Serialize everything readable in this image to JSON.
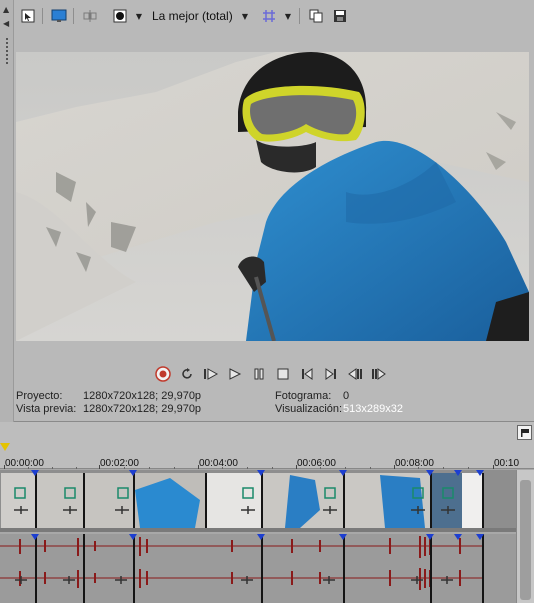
{
  "preview": {
    "toolbar": {
      "quality": "La mejor (total)",
      "icons": [
        "preview-properties-icon",
        "external-monitor-icon",
        "split-screen-icon",
        "adjust-size-icon",
        "overlays-icon",
        "copy-snapshot-icon",
        "save-snapshot-icon"
      ]
    },
    "info": {
      "project_label": "Proyecto:",
      "project_value": "1280x720x128; 29,970p",
      "preview_label": "Vista previa:",
      "preview_value": "1280x720x128; 29,970p",
      "frame_label": "Fotograma:",
      "frame_value": "0",
      "display_label": "Visualización:",
      "display_value": "513x289x32"
    },
    "transport": [
      "record-icon",
      "loop-icon",
      "play-from-start-icon",
      "play-icon",
      "pause-icon",
      "stop-icon",
      "go-to-start-icon",
      "go-to-end-icon",
      "previous-frame-icon",
      "next-frame-icon"
    ]
  },
  "timeline": {
    "ruler_labels": [
      "00:00:00",
      "00:02:00",
      "00:04:00",
      "00:06:00",
      "00:08:00",
      "00:10"
    ]
  },
  "colors": {
    "record_red": "#c0392b",
    "marker_blue": "#1d3fd0",
    "playhead_yellow": "#e4c300",
    "waveform_red": "#8a1a1a"
  }
}
